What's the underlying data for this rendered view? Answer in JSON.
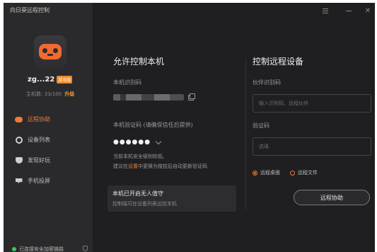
{
  "app": {
    "title": "向日葵远程控制"
  },
  "sidebar": {
    "username": "zg...22",
    "badge": "游戏版",
    "quota_text": "主机数: 33/100",
    "upgrade": "升级",
    "nav": [
      {
        "label": "远程协助",
        "icon": "remote-assist-icon",
        "active": true
      },
      {
        "label": "设备列表",
        "icon": "device-list-icon",
        "active": false
      },
      {
        "label": "发现好玩",
        "icon": "discover-icon",
        "active": false
      },
      {
        "label": "手机投屏",
        "icon": "screen-cast-icon",
        "active": false
      }
    ],
    "status": "已连接安全加密链路"
  },
  "allow": {
    "title": "允许控制本机",
    "machine_id_label": "本机识别码",
    "verify_label": "本机验证码 (请确保信任后提供)",
    "verify_code": "●●●●●●",
    "hint_line1": "当前本机安全级别较低,",
    "hint_line2_a": "建议在",
    "hint_line2_link": "设置",
    "hint_line2_b": "中更换为按控后自动更新验证码",
    "unattended_title": "本机已开启无人值守",
    "unattended_sub": "控制端可在设备列表远控本机"
  },
  "remote": {
    "title": "控制远程设备",
    "partner_label": "伙伴识别码",
    "partner_placeholder": "输入识别码、远程伙伴",
    "code_label": "验证码",
    "code_placeholder": "选填",
    "radio_desktop": "远程桌面",
    "radio_file": "远程文件",
    "button": "远程协助"
  },
  "colors": {
    "accent": "#f07a3a",
    "background": "#1f1f21",
    "sidebar": "#2a2a2c"
  }
}
